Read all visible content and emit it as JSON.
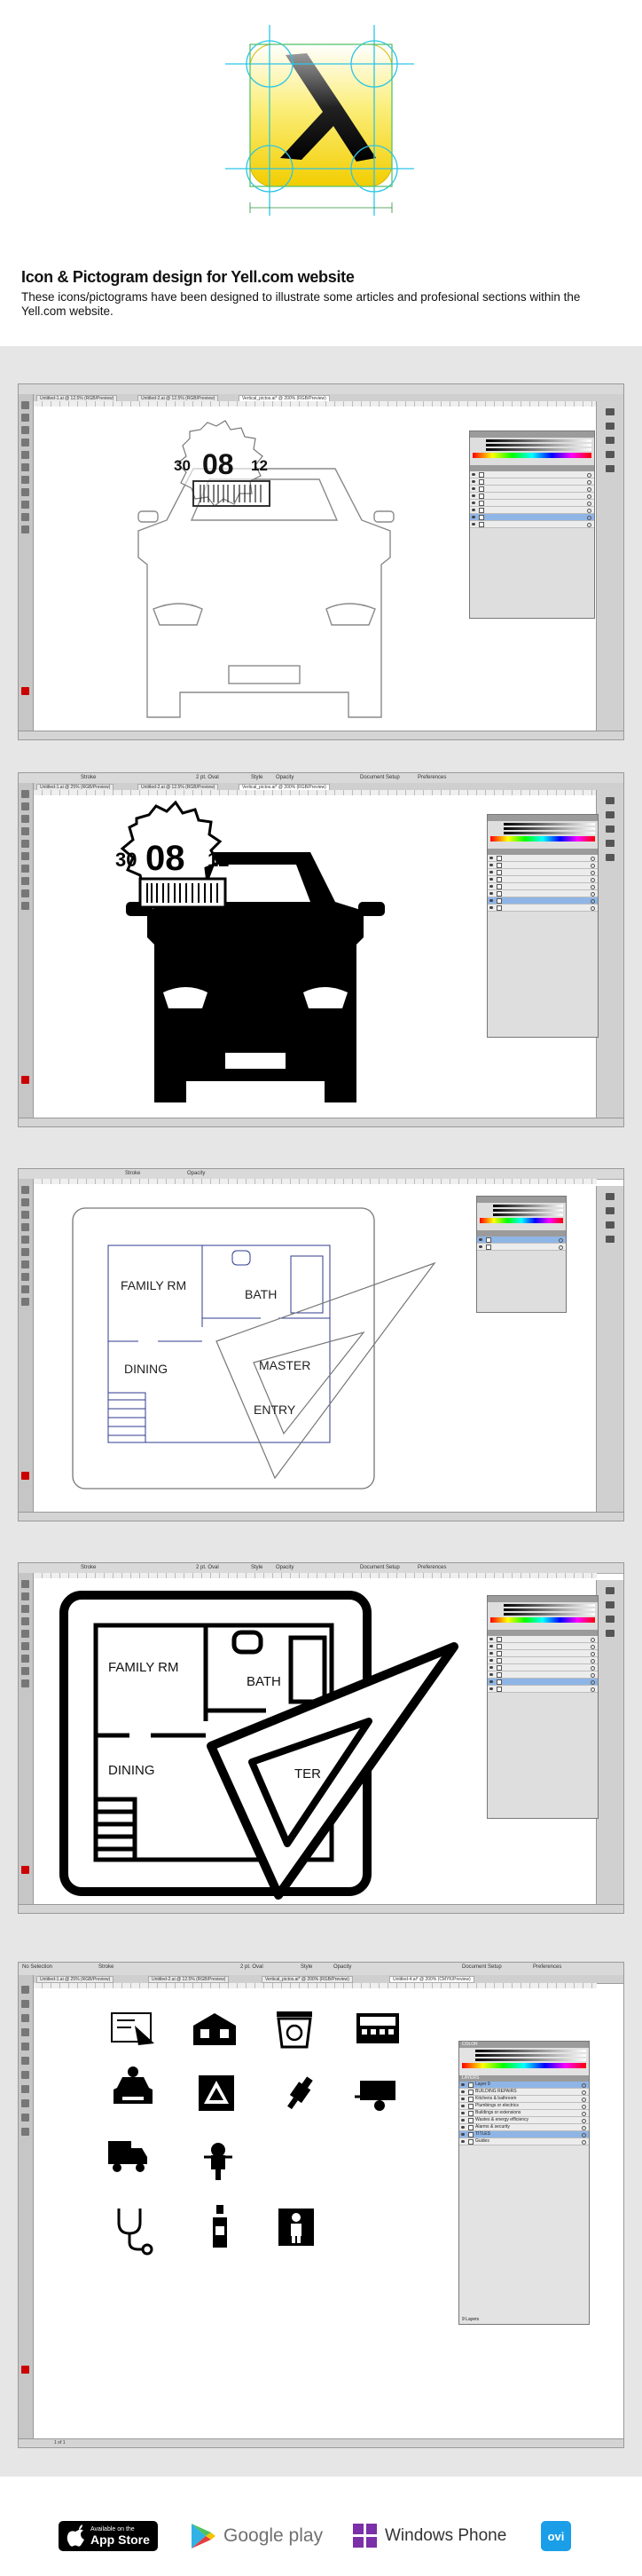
{
  "header": {
    "title": "Icon & Pictogram design for Yell.com website",
    "description": "These icons/pictograms have been designed to illustrate some articles and profesional sections within the Yell.com website."
  },
  "colors": {
    "logo_yellow": "#f5d80c",
    "guide_cyan": "#2cc5e6",
    "gallery_bg": "#e6e6e6",
    "layer_selected": "#8fb5e6"
  },
  "shots": [
    {
      "name": "car-mot-outline",
      "tabs": [
        "Untitled-1.ai @ 12.5% (RGB/Preview)",
        "Untitled-2.ai @ 12.5% (RGB/Preview)",
        "Vertical_pictos.ai* @ 200% (RGB/Preview)"
      ],
      "date": [
        "30",
        "08",
        "12"
      ]
    },
    {
      "name": "car-mot-filled",
      "tabs": [
        "Untitled-1.ai @ 25% (RGB/Preview)",
        "Untitled-2.ai @ 12.5% (RGB/Preview)",
        "Vertical_pictos.ai* @ 200% (RGB/Preview)"
      ],
      "toolbar": [
        "Stroke",
        "2 pt. Oval",
        "Style",
        "Opacity",
        "Document Setup",
        "Preferences"
      ],
      "date": [
        "30",
        "08",
        "12"
      ]
    },
    {
      "name": "floorplan-outline",
      "toolbar": [
        "Stroke",
        "Opacity"
      ],
      "rooms": [
        "FAMILY RM",
        "BATH",
        "DINING",
        "MASTER",
        "ENTRY"
      ]
    },
    {
      "name": "floorplan-filled",
      "toolbar": [
        "Stroke",
        "2 pt. Oval",
        "Style",
        "Opacity",
        "Document Setup",
        "Preferences"
      ],
      "rooms": [
        "FAMILY RM",
        "BATH",
        "DINING",
        "TER"
      ]
    },
    {
      "name": "icon-set",
      "toolbar": [
        "No Selection",
        "Stroke",
        "2 pt. Oval",
        "Style",
        "Opacity",
        "Document Setup",
        "Preferences"
      ],
      "tabs": [
        "Untitled-1.ai @ 25% (RGB/Preview)",
        "Untitled-2.ai @ 12.5% (RGB/Preview)",
        "Vertical_pictos.ai* @ 200% (RGB/Preview)",
        "Untitled-4.ai* @ 200% (CMYK/Preview)"
      ],
      "status": "1 of 1",
      "layers_title": "LAYERS",
      "color_title": "COLOR",
      "layers_count": "9 Layers",
      "layers": [
        "Layer 9",
        "BUILDING REPAIRS",
        "Kitchens & bathroom",
        "Plumbings or electrics",
        "Buildings or extensions",
        "Wastes & energy efficiency",
        "Alarms & security",
        "TITLES",
        "Guides"
      ]
    }
  ],
  "stores": {
    "appstore_small": "Available on the",
    "appstore_big": "App Store",
    "googleplay": "Google play",
    "windowsphone": "Windows Phone",
    "ovi": "ovi"
  }
}
